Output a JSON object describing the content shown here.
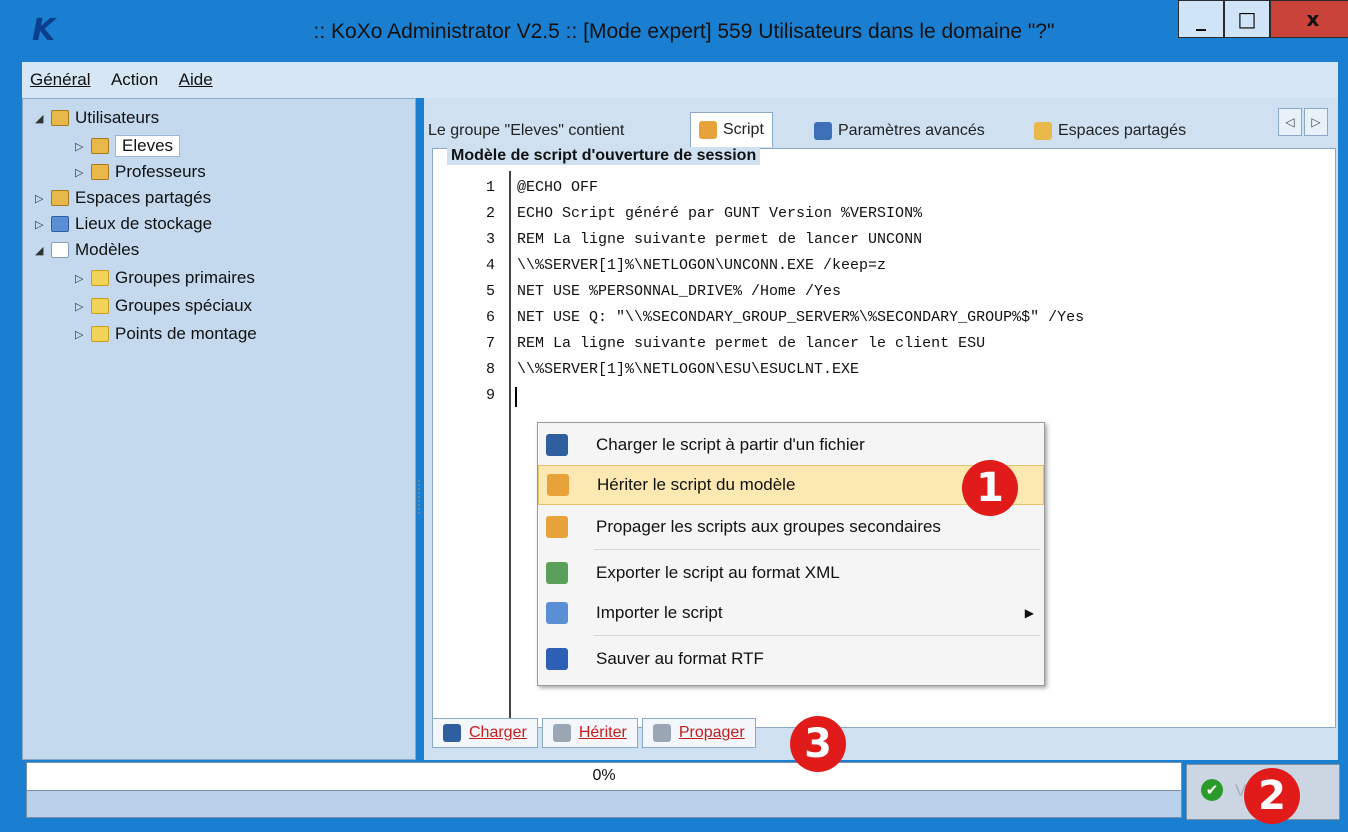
{
  "window": {
    "title": ":: KoXo Administrator V2.5 :: [Mode expert] 559 Utilisateurs dans le domaine \"?\"",
    "minimize": "_",
    "maximize": "□",
    "close": "x"
  },
  "menubar": {
    "items": [
      {
        "label": "Général",
        "accel": "G"
      },
      {
        "label": "Action",
        "accel": "c"
      },
      {
        "label": "Aide",
        "accel": "A"
      }
    ]
  },
  "tree": {
    "items": [
      {
        "label": "Utilisateurs",
        "expanded": true
      },
      {
        "label": "Eleves",
        "selected": true
      },
      {
        "label": "Professeurs"
      },
      {
        "label": "Espaces partagés"
      },
      {
        "label": "Lieux de stockage"
      },
      {
        "label": "Modèles",
        "expanded": true
      },
      {
        "label": "Groupes primaires"
      },
      {
        "label": "Groupes spéciaux"
      },
      {
        "label": "Points de montage"
      }
    ]
  },
  "tabs": [
    {
      "label": "Le groupe \"Eleves\" contient"
    },
    {
      "label": "Script",
      "active": true
    },
    {
      "label": "Paramètres avancés"
    },
    {
      "label": "Espaces partagés"
    }
  ],
  "editor": {
    "group_title": "Modèle de script d'ouverture de session",
    "line_numbers": [
      "1",
      "2",
      "3",
      "4",
      "5",
      "6",
      "7",
      "8",
      "9"
    ],
    "lines": [
      "@ECHO OFF",
      "ECHO Script généré par GUNT Version %VERSION%",
      "REM La ligne suivante permet de lancer UNCONN",
      "\\\\%SERVER[1]%\\NETLOGON\\UNCONN.EXE /keep=z",
      "NET USE %PERSONNAL_DRIVE% /Home /Yes",
      "NET USE Q: \"\\\\%SECONDARY_GROUP_SERVER%\\%SECONDARY_GROUP%$\" /Yes",
      "REM La ligne suivante permet de lancer le client ESU",
      "\\\\%SERVER[1]%\\NETLOGON\\ESU\\ESUCLNT.EXE",
      ""
    ]
  },
  "context_menu": {
    "items": [
      {
        "label": "Charger le script à partir d'un fichier",
        "icon": "load-icon"
      },
      {
        "label": "Hériter le script du modèle",
        "icon": "gear-icon",
        "hover": true
      },
      {
        "label": "Propager les scripts aux groupes secondaires",
        "icon": "gear-icon"
      },
      {
        "label": "Exporter le script au format XML",
        "icon": "xml-export-icon"
      },
      {
        "label": "Importer le script",
        "icon": "import-icon",
        "submenu": true
      },
      {
        "label": "Sauver au format RTF",
        "icon": "word-icon"
      }
    ]
  },
  "bottom_buttons": [
    {
      "label": "Charger",
      "icon": "load-icon"
    },
    {
      "label": "Hériter",
      "icon": "gear-icon"
    },
    {
      "label": "Propager",
      "icon": "gear-icon"
    }
  ],
  "progress": {
    "text": "0%",
    "value": 0
  },
  "ok_button": {
    "label": "Valider"
  },
  "badges": [
    "1",
    "2",
    "3"
  ],
  "colors": {
    "title_bg": "#1b7fd1",
    "panel_bg": "#c4d9ee",
    "badge_red": "#e11a1a",
    "menu_hover": "#fbe9b1",
    "code_green": "#1a8a1a",
    "code_blue": "#1848d0",
    "link_red": "#c81c1c"
  }
}
